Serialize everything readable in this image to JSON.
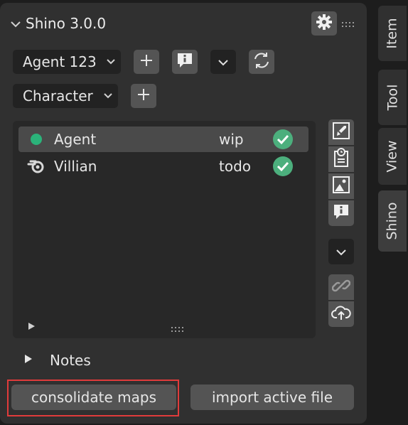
{
  "panel": {
    "title": "Shino 3.0.0",
    "collapse_icon": "chevron-down-icon",
    "settings_icon": "gear-icon"
  },
  "agent_row": {
    "agent_select": "Agent 123",
    "add_icon": "plus-icon",
    "info_icon": "info-speech-icon",
    "dropdown_icon": "chevron-down-icon",
    "refresh_icon": "refresh-icon"
  },
  "character_row": {
    "character_select": "Character",
    "add_icon": "plus-icon"
  },
  "list": {
    "items": [
      {
        "name": "Agent",
        "status": "wip",
        "icon": "green-dot-icon",
        "check": "check-circle-icon"
      },
      {
        "name": "Villian",
        "status": "todo",
        "icon": "blender-icon",
        "check": "check-circle-icon"
      }
    ]
  },
  "notes": {
    "label": "Notes"
  },
  "buttons": {
    "consolidate": "consolidate maps",
    "import": "import active file"
  },
  "tabs": [
    "Item",
    "Tool",
    "View",
    "Shino"
  ],
  "colors": {
    "panel_bg": "#303030",
    "button_bg": "#545454",
    "field_bg": "#222222",
    "accent_green": "#2bb37a",
    "check_green": "#4caf7d",
    "highlight": "#e03b3b"
  }
}
